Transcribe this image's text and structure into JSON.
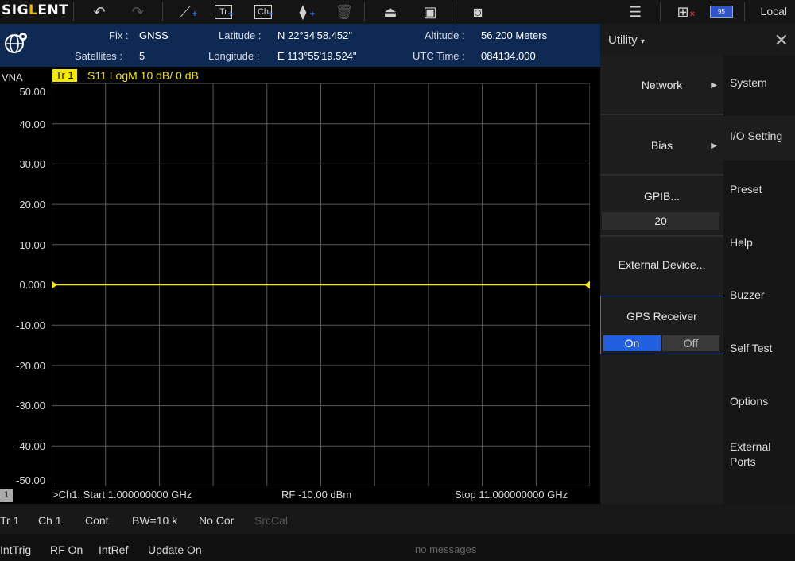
{
  "toolbar": {
    "logo": "SIGLENT",
    "local_label": "Local",
    "battery_value": "95",
    "icons": [
      "undo-icon",
      "redo-icon",
      "measurement-icon",
      "add-trace-icon",
      "add-channel-icon",
      "add-marker-icon",
      "delete-icon",
      "recall-icon",
      "save-icon",
      "screenshot-icon",
      "menu-icon",
      "network-icon"
    ]
  },
  "gps": {
    "fix_label": "Fix :",
    "fix_value": "GNSS",
    "satellites_label": "Satellites :",
    "satellites_value": "5",
    "latitude_label": "Latitude :",
    "latitude_value": "N 22°34'58.452\"",
    "longitude_label": "Longitude :",
    "longitude_value": "E 113°55'19.524\"",
    "altitude_label": "Altitude :",
    "altitude_value": "56.200 Meters",
    "utc_label": "UTC Time :",
    "utc_value": "084134.000"
  },
  "plot": {
    "vna_label": "VNA",
    "trace_badge": "Tr 1",
    "trace_info": "S11  LogM  10 dB/  0 dB",
    "y_ticks": [
      "50.00",
      "40.00",
      "30.00",
      "20.00",
      "10.00",
      "0.000",
      "-10.00",
      "-20.00",
      "-30.00",
      "-40.00",
      "-50.00"
    ],
    "start_label": ">Ch1: Start  1.000000000 GHz",
    "rf_label": "RF -10.00 dBm",
    "stop_label": "Stop  11.000000000 GHz",
    "channel_box": "1",
    "trace_color": "#f4e800"
  },
  "chart_data": {
    "type": "line",
    "x": [
      "1.000000000 GHz",
      "11.000000000 GHz"
    ],
    "series": [
      {
        "name": "Tr 1",
        "values": [
          0,
          0
        ]
      }
    ],
    "ylim": [
      -50,
      50
    ],
    "grid": true
  },
  "status1": [
    "Tr 1",
    "Ch 1",
    "Cont",
    "BW=10 k",
    "No Cor",
    "SrcCal"
  ],
  "status2": [
    "IntTrig",
    "RF On",
    "IntRef",
    "Update On"
  ],
  "message": "no messages",
  "utility": {
    "title": "Utility",
    "menu": {
      "network": "Network",
      "bias": "Bias",
      "gpib_label": "GPIB...",
      "gpib_value": "20",
      "external_device": "External Device...",
      "gps_receiver": "GPS Receiver",
      "gps_on": "On",
      "gps_off": "Off"
    },
    "side": {
      "system": "System",
      "io_setting": "I/O Setting",
      "preset": "Preset",
      "help": "Help",
      "buzzer": "Buzzer",
      "self_test": "Self Test",
      "options": "Options",
      "external_ports_1": "External",
      "external_ports_2": "Ports"
    }
  }
}
